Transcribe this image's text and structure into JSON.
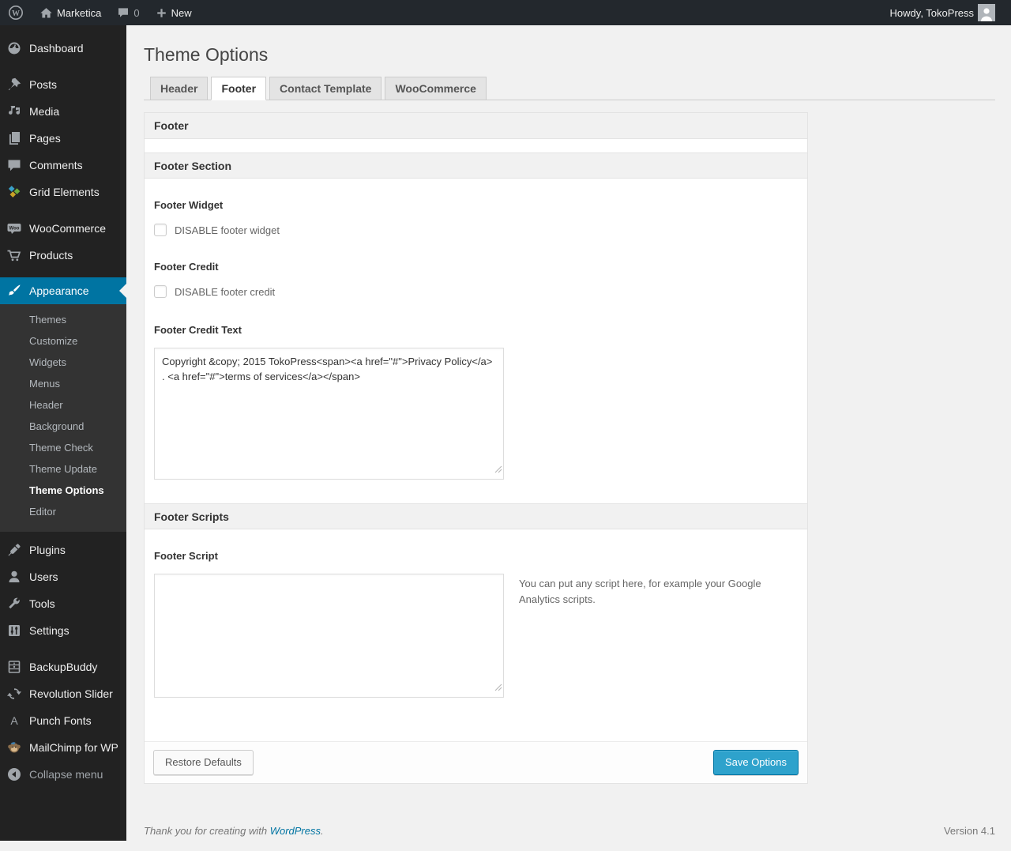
{
  "admin_bar": {
    "site_name": "Marketica",
    "comment_count": "0",
    "new_label": "New",
    "howdy": "Howdy, TokoPress"
  },
  "sidebar": {
    "items": [
      {
        "label": "Dashboard"
      },
      {
        "label": "Posts"
      },
      {
        "label": "Media"
      },
      {
        "label": "Pages"
      },
      {
        "label": "Comments"
      },
      {
        "label": "Grid Elements"
      },
      {
        "label": "WooCommerce"
      },
      {
        "label": "Products"
      },
      {
        "label": "Appearance"
      },
      {
        "label": "Plugins"
      },
      {
        "label": "Users"
      },
      {
        "label": "Tools"
      },
      {
        "label": "Settings"
      },
      {
        "label": "BackupBuddy"
      },
      {
        "label": "Revolution Slider"
      },
      {
        "label": "Punch Fonts"
      },
      {
        "label": "MailChimp for WP"
      },
      {
        "label": "Collapse menu"
      }
    ],
    "appearance_submenu": [
      {
        "label": "Themes"
      },
      {
        "label": "Customize"
      },
      {
        "label": "Widgets"
      },
      {
        "label": "Menus"
      },
      {
        "label": "Header"
      },
      {
        "label": "Background"
      },
      {
        "label": "Theme Check"
      },
      {
        "label": "Theme Update"
      },
      {
        "label": "Theme Options"
      },
      {
        "label": "Editor"
      }
    ]
  },
  "main": {
    "title": "Theme Options",
    "tabs": [
      {
        "label": "Header",
        "active": false
      },
      {
        "label": "Footer",
        "active": true
      },
      {
        "label": "Contact Template",
        "active": false
      },
      {
        "label": "WooCommerce",
        "active": false
      }
    ],
    "panel_header": "Footer",
    "section_title": "Footer Section",
    "footer_widget": {
      "label": "Footer Widget",
      "checkbox_label": "DISABLE footer widget",
      "checked": false
    },
    "footer_credit": {
      "label": "Footer Credit",
      "checkbox_label": "DISABLE footer credit",
      "checked": false
    },
    "footer_credit_text": {
      "label": "Footer Credit Text",
      "value": "Copyright &copy; 2015 TokoPress<span><a href=\"#\">Privacy Policy</a> . <a href=\"#\">terms of services</a></span>"
    },
    "scripts_section_title": "Footer Scripts",
    "footer_script": {
      "label": "Footer Script",
      "value": "",
      "help": "You can put any script here, for example your Google Analytics scripts."
    },
    "buttons": {
      "restore": "Restore Defaults",
      "save": "Save Options"
    }
  },
  "page_footer": {
    "thanks_prefix": "Thank you for creating with ",
    "wordpress_link": "WordPress",
    "thanks_suffix": ".",
    "version": "Version 4.1"
  },
  "colors": {
    "accent": "#0074a2",
    "primary_button": "#2ea2cc",
    "admin_bar_bg": "#23282d",
    "menu_bg": "#222222",
    "submenu_bg": "#333333",
    "page_bg": "#f1f1f1"
  }
}
